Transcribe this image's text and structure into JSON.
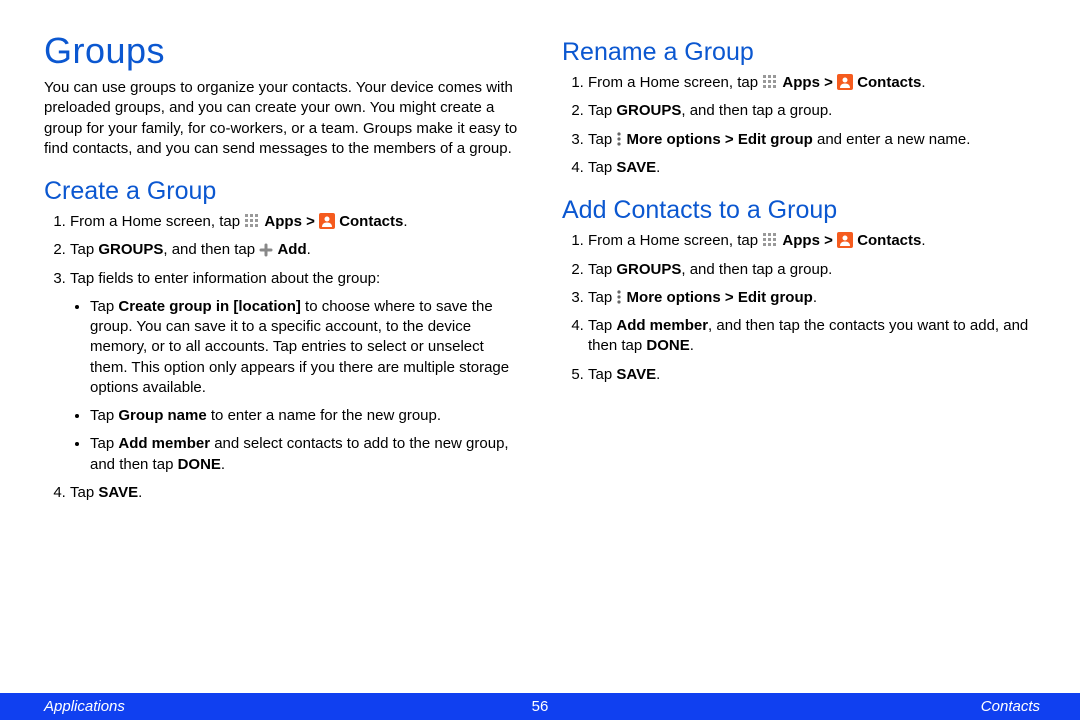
{
  "title": "Groups",
  "intro": "You can use groups to organize your contacts. Your device comes with preloaded groups, and you can create your own. You might create a group for your family, for co-workers, or a team. Groups make it easy to find contacts, and you can send messages to the members of a group.",
  "create": {
    "heading": "Create a Group",
    "s1_a": "From a Home screen, tap ",
    "apps": "Apps",
    "gt": " > ",
    "contacts": "Contacts",
    "s2_a": "Tap ",
    "groups": "GROUPS",
    "s2_b": ", and then tap ",
    "add": "Add",
    "s3": "Tap fields to enter information about the group:",
    "b1_a": "Tap ",
    "b1_bold": "Create group in [location]",
    "b1_b": " to choose where to save the group. You can save it to a specific account, to the device memory, or to all accounts. Tap entries to select or unselect them. This option only appears if you there are multiple storage options available.",
    "b2_a": "Tap ",
    "b2_bold": "Group name",
    "b2_b": " to enter a name for the new group.",
    "b3_a": "Tap ",
    "b3_bold": "Add member",
    "b3_b": " and select contacts to add to the new group, and then tap ",
    "done": "DONE",
    "s4_a": "Tap ",
    "save": "SAVE"
  },
  "rename": {
    "heading": "Rename a Group",
    "s1_a": "From a Home screen, tap ",
    "s2_a": "Tap ",
    "s2_b": ", and then tap a group.",
    "s3_a": "Tap ",
    "more": "More options",
    "edit": "Edit group",
    "s3_b": " and enter a new name.",
    "s4_a": "Tap "
  },
  "addc": {
    "heading": "Add Contacts to a Group",
    "s4_a": "Tap ",
    "s4_bold": "Add member",
    "s4_b": ", and then tap the contacts you want to add, and then tap ",
    "s5_a": "Tap "
  },
  "footer": {
    "left": "Applications",
    "page": "56",
    "right": "Contacts"
  },
  "period": "."
}
